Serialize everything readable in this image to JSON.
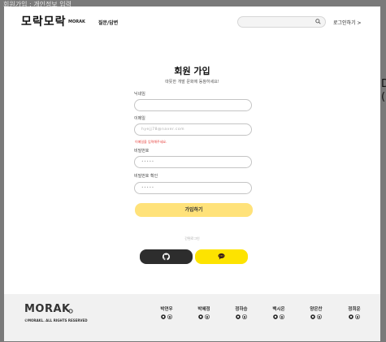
{
  "caption": "회원가입 : 개인정보 입력",
  "side_text": "D\n(",
  "header": {
    "logo": "모락모락",
    "logo_sub": "MORAK",
    "nav_qa": "질문/답변",
    "search_placeholder": "",
    "login": "로그인하기 >"
  },
  "form": {
    "title": "회원 가입",
    "subtitle": "따뜻한 개발 문화에 동참하세요!",
    "nickname_label": "닉네임",
    "nickname_value": "",
    "email_label": "이메일",
    "email_placeholder": "hyejj78@naver.com",
    "email_error": "이메일을 입력해주세요.",
    "password_label": "비밀번호",
    "password_value": "•••••",
    "confirm_label": "비밀번호 확인",
    "confirm_value": "•••••",
    "submit": "가입하기",
    "easy_login": "간편로그인"
  },
  "footer": {
    "logo": "MORAK",
    "copyright": "©MORAKL. ALL RIGHTS RESERVED",
    "members": [
      "박연우",
      "박혜정",
      "정하승",
      "백시은",
      "양은찬",
      "정희운"
    ]
  },
  "colors": {
    "accent_yellow": "#ffe27a",
    "kakao_yellow": "#fde300",
    "github_dark": "#2d2d2d",
    "error_red": "#e53935",
    "footer_bg": "#f1f1f1"
  }
}
